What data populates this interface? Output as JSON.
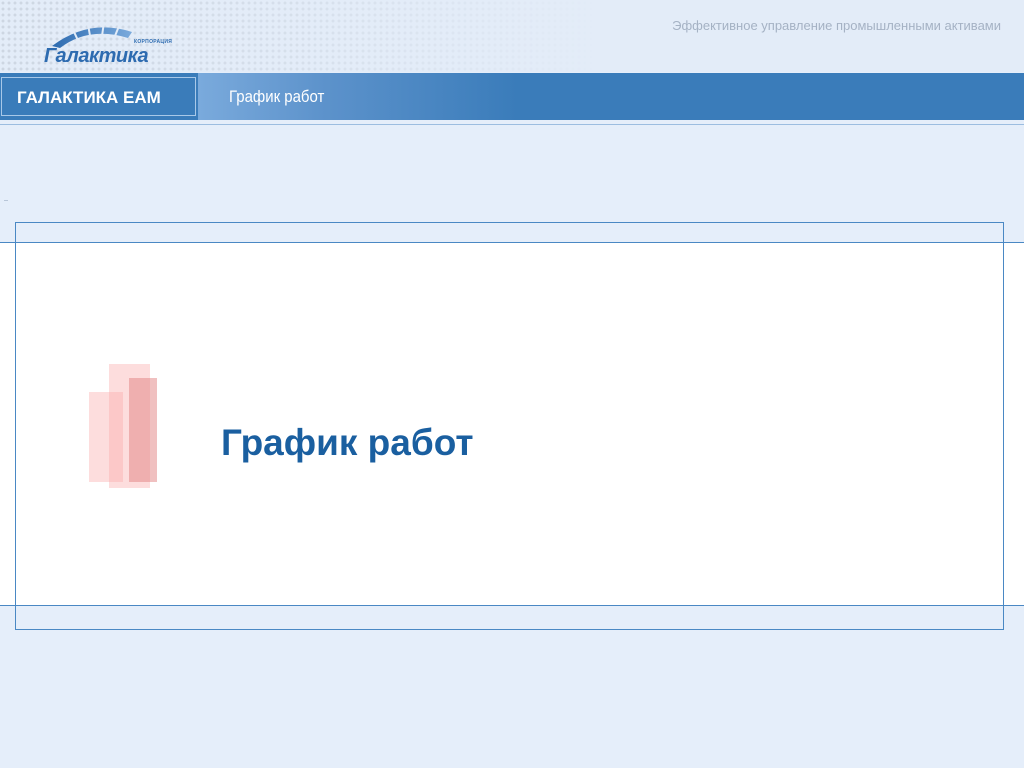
{
  "header": {
    "logo_text": "Галактика",
    "logo_corp": "КОРПОРАЦИЯ",
    "tagline": "Эффективное управление промышленными активами"
  },
  "bar": {
    "brand": "ГАЛАКТИКА EAM",
    "section_title": "График работ"
  },
  "content": {
    "title": "График работ"
  },
  "colors": {
    "bar_blue": "#3a7cba",
    "title_blue": "#1a5fa0",
    "background": "#e5eefa",
    "accent_pink": "#f4b0b0"
  }
}
